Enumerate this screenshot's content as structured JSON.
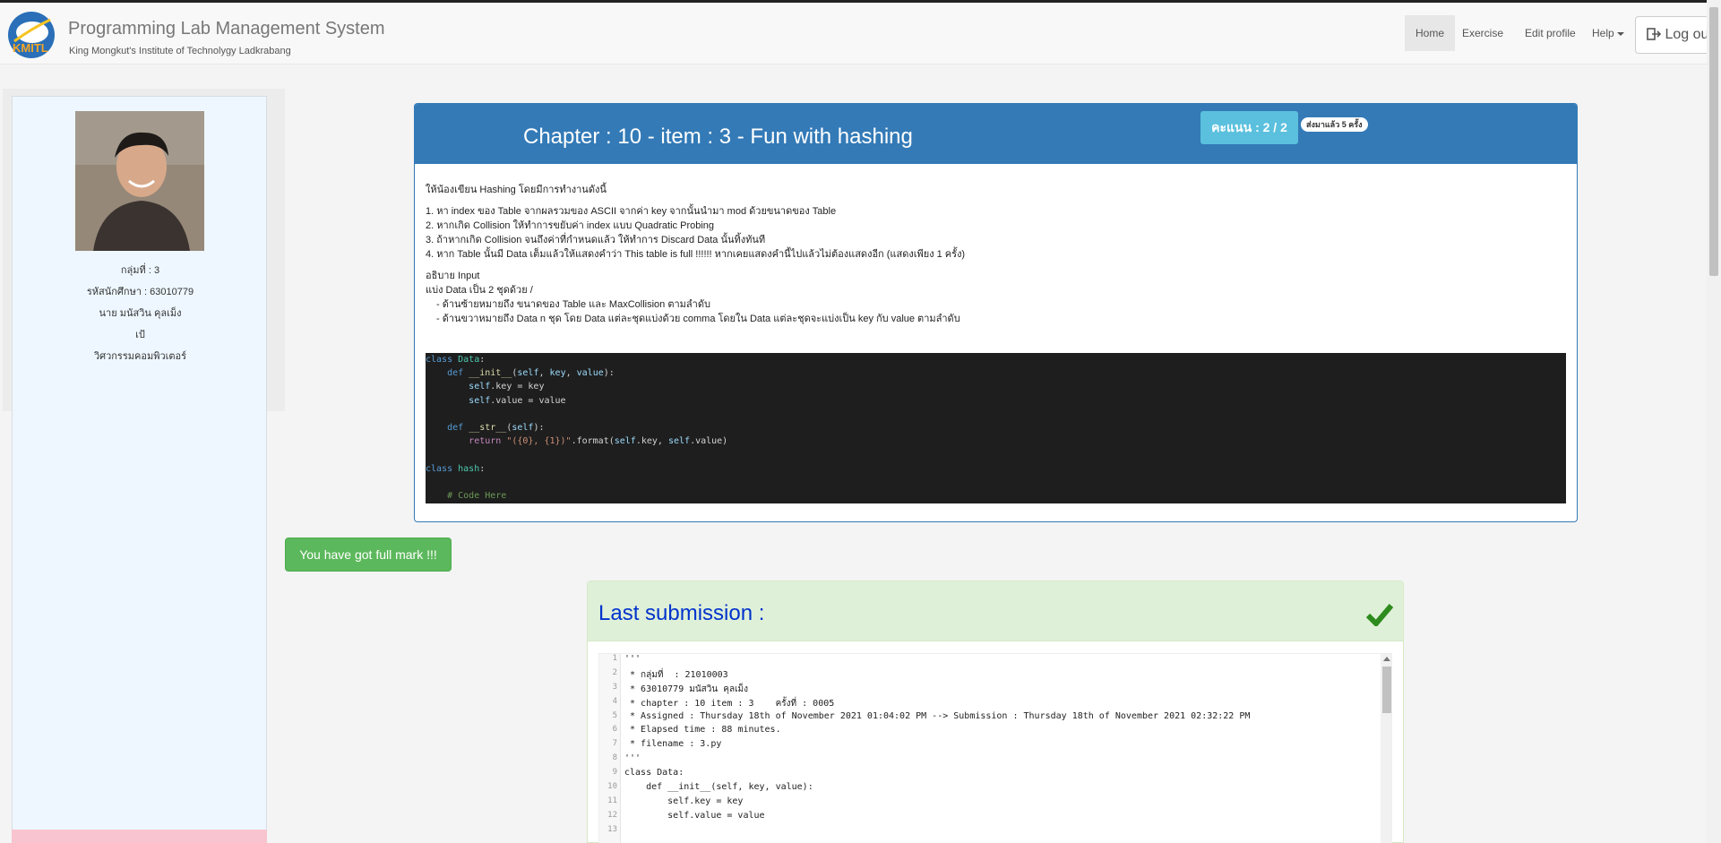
{
  "navbar": {
    "title": "Programming Lab Management System",
    "subtitle": "King Mongkut's Institute of Technolygy Ladkrabang",
    "logo_text": "KMITL",
    "items": [
      "Home",
      "Exercise",
      "Edit profile",
      "Help"
    ],
    "logout": "Log out"
  },
  "profile": {
    "group": "กลุ่มที่ : 3",
    "student_id": "รหัสนักศึกษา : 63010779",
    "name": "นาย มนัสวิน คุลเม็ง",
    "nickname": "เป้",
    "department": "วิศวกรรมคอมพิวเตอร์"
  },
  "problem": {
    "title": "Chapter : 10 - item : 3 - Fun with hashing",
    "score": "คะแนน : 2 / 2",
    "sent_count": "ส่งมาแล้ว 5 ครั้ง",
    "intro": "ให้น้องเขียน Hashing โดยมีการทำงานดังนี้",
    "steps": [
      "1. หา index ของ Table จากผลรวมของ ASCII จากค่า key จากนั้นนำมา mod ด้วยขนาดของ Table",
      "2. หากเกิด Collision ให้ทำการขยับค่า index แบบ Quadratic Probing",
      "3. ถ้าหากเกิด Collision จนถึงค่าที่กำหนดแล้ว ให้ทำการ Discard Data นั้นทิ้งทันที",
      "4. หาก Table นั้นมี Data เต็มแล้วให้แสดงคำว่า This table is full !!!!!! หากเคยแสดงคำนี้ไปแล้วไม่ต้องแสดงอีก (แสดงเพียง 1 ครั้ง)"
    ],
    "input_heading": "อธิบาย Input",
    "input_desc": "แบ่ง Data เป็น 2 ชุดด้วย /",
    "input_items": [
      "-   ด้านซ้ายหมายถึง ขนาดของ Table และ MaxCollision ตามลำดับ",
      "-   ด้านขวาหมายถึง Data n ชุด โดย Data แต่ละชุดแบ่งด้วย comma โดยใน Data แต่ละชุดจะแบ่งเป็น key กับ value ตามลำดับ"
    ],
    "code": {
      "l1": "class",
      "l1b": "Data",
      "l2": "def",
      "l2b": "__init__",
      "l2c": "self",
      "l2d": "key",
      "l2e": "value",
      "l3a": "self",
      "l3b": ".key = key",
      "l4a": "self",
      "l4b": ".value = value",
      "l6": "def",
      "l6b": "__str__",
      "l6c": "self",
      "l7": "return",
      "l7b": "\"({0}, {1})\"",
      "l7c": ".format(",
      "l7d": "self",
      "l7e": ".key, ",
      "l7f": "self",
      "l7g": ".value)",
      "l9": "class",
      "l9b": "hash",
      "l11": "# Code Here"
    }
  },
  "full_mark": "You have got full mark !!!",
  "last_submission": {
    "title": "Last submission :",
    "line_numbers": [
      "1",
      "2",
      "3",
      "4",
      "5",
      "6",
      "7",
      "8",
      "9",
      "10",
      "11",
      "12",
      "13"
    ],
    "lines": [
      "'''",
      " * กลุ่มที่  : 21010003",
      " * 63010779 มนัสวิน คุลเม็ง",
      " * chapter : 10 item : 3    ครั้งที่ : 0005",
      " * Assigned : Thursday 18th of November 2021 01:04:02 PM --> Submission : Thursday 18th of November 2021 02:32:22 PM",
      " * Elapsed time : 88 minutes.",
      " * filename : 3.py",
      "'''",
      "class Data:",
      "    def __init__(self, key, value):",
      "        self.key = key",
      "        self.value = value",
      ""
    ]
  },
  "colors": {
    "primary": "#337ab7",
    "info": "#5bc0de",
    "success": "#5cb85c",
    "success_bg": "#dff0d8",
    "last_title": "#0033cc"
  }
}
